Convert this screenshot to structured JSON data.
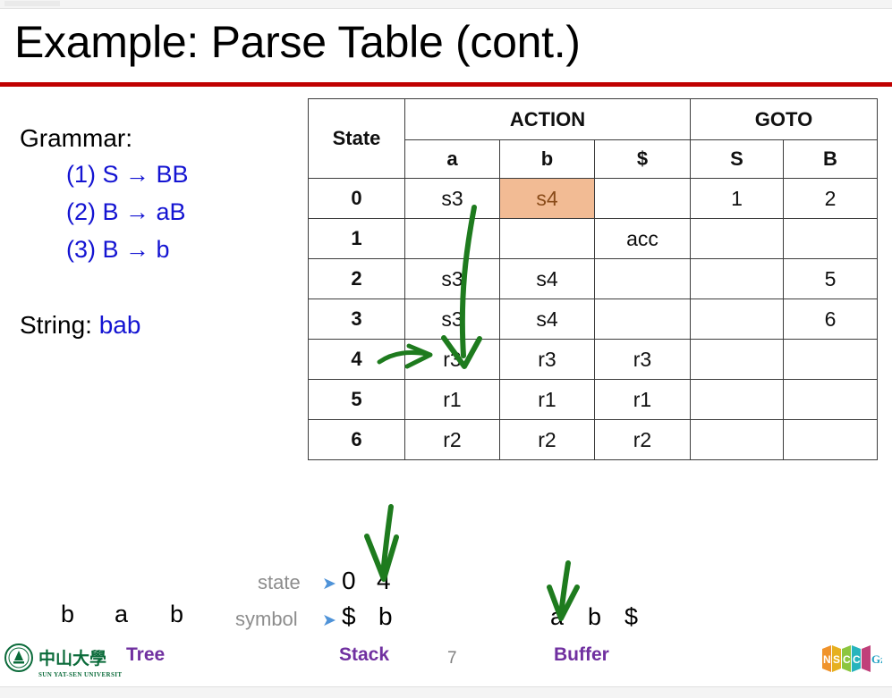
{
  "slide": {
    "title": "Example: Parse Table (cont.)",
    "page_number": "7",
    "accent_rule_color": "#C00000",
    "highlight_bg": "#F2BB94",
    "highlight_fg": "#8A4B19",
    "annotation_color": "#1E7B1E",
    "label_color": "#7030A0"
  },
  "grammar": {
    "heading": "Grammar:",
    "productions": [
      "(1) S → BB",
      "(2) B → aB",
      "(3) B → b"
    ],
    "production_color": "#1414D2",
    "string_label": "String:",
    "string_value": "bab"
  },
  "parse_table": {
    "group_headers": {
      "state": "State",
      "action": "ACTION",
      "goto": "GOTO"
    },
    "sub_headers": [
      "a",
      "b",
      "$",
      "S",
      "B"
    ],
    "rows": [
      {
        "state": "0",
        "a": "s3",
        "b": "s4",
        "dollar": "",
        "S": "1",
        "B": "2"
      },
      {
        "state": "1",
        "a": "",
        "b": "",
        "dollar": "acc",
        "S": "",
        "B": ""
      },
      {
        "state": "2",
        "a": "s3",
        "b": "s4",
        "dollar": "",
        "S": "",
        "B": "5"
      },
      {
        "state": "3",
        "a": "s3",
        "b": "s4",
        "dollar": "",
        "S": "",
        "B": "6"
      },
      {
        "state": "4",
        "a": "r3",
        "b": "r3",
        "dollar": "r3",
        "S": "",
        "B": ""
      },
      {
        "state": "5",
        "a": "r1",
        "b": "r1",
        "dollar": "r1",
        "S": "",
        "B": ""
      },
      {
        "state": "6",
        "a": "r2",
        "b": "r2",
        "dollar": "r2",
        "S": "",
        "B": ""
      }
    ],
    "highlight": {
      "row": 0,
      "column": "b",
      "value": "s4"
    }
  },
  "tree": {
    "label": "Tree",
    "symbols": [
      "b",
      "a",
      "b"
    ]
  },
  "stack": {
    "label": "Stack",
    "state_row_label": "state",
    "symbol_row_label": "symbol",
    "states": [
      "0",
      "4"
    ],
    "symbols": [
      "$",
      "b"
    ]
  },
  "buffer": {
    "label": "Buffer",
    "symbols": [
      "a",
      "b",
      "$"
    ]
  },
  "logos": {
    "university": {
      "chinese_name": "中山大學",
      "english_name": "SUN YAT-SEN UNIVERSITY"
    },
    "center": {
      "letters": [
        "N",
        "S",
        "C",
        "C"
      ],
      "suffix": "Gz",
      "panel_colors": [
        "#F0932B",
        "#9ACD32",
        "#3CB8C4",
        "#C0407A"
      ]
    }
  }
}
